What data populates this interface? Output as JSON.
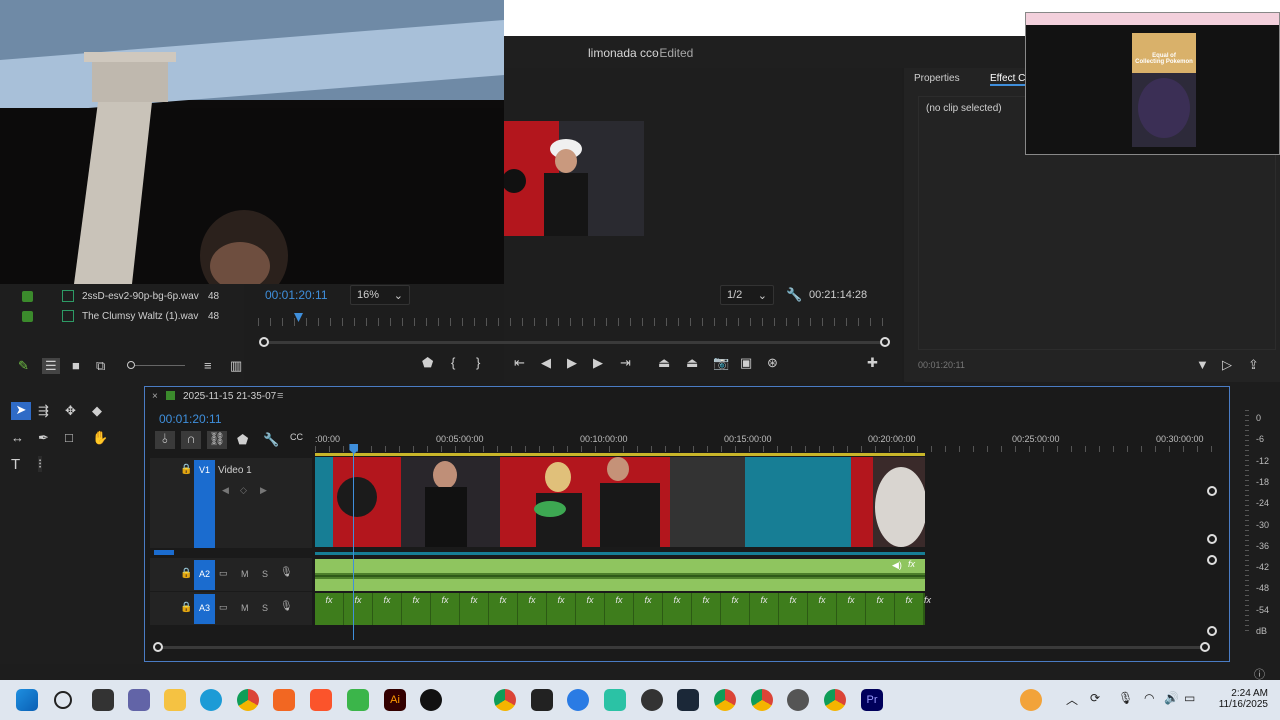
{
  "window": {
    "project_title": "limonada cco",
    "project_status": "- Edited"
  },
  "right_panel": {
    "tabs": [
      "Properties",
      "Effect Co"
    ],
    "no_clip": "(no clip selected)",
    "timecode": "00:01:20:11"
  },
  "program_monitor": {
    "current_timecode": "00:01:20:11",
    "zoom": "16%",
    "resolution": "1/2",
    "duration": "00:21:14:28"
  },
  "project_bin": {
    "items": [
      {
        "name": "2ssD-esv2-90p-bg-6p.wav",
        "count": "48"
      },
      {
        "name": "The Clumsy Waltz (1).wav",
        "count": "48"
      }
    ]
  },
  "timeline": {
    "sequence_name": "2025-11-15 21-35-07",
    "timecode": "00:01:20:11",
    "ruler": [
      ":00:00",
      "00:05:00:00",
      "00:10:00:00",
      "00:15:00:00",
      "00:20:00:00",
      "00:25:00:00",
      "00:30:00:00"
    ],
    "playhead_fraction": 0.063,
    "tracks": {
      "v1": {
        "id": "V1",
        "name": "Video 1"
      },
      "a2": {
        "id": "A2",
        "m": "M",
        "s": "S"
      },
      "a3": {
        "id": "A3",
        "m": "M",
        "s": "S"
      }
    },
    "fx_label": "fx"
  },
  "audio_meter": {
    "labels": [
      "0",
      "-6",
      "-12",
      "-18",
      "-24",
      "-30",
      "-36",
      "-42",
      "-48",
      "-54",
      "dB"
    ]
  },
  "pip": {
    "caption_line1": "Equal of",
    "caption_line2": "Collecting Pokemon"
  },
  "taskbar": {
    "time": "2:24 AM",
    "date": "11/16/2025"
  },
  "colors": {
    "accent_blue": "#3f8fdc",
    "track_blue": "#1b6ccf",
    "audio_green": "#3e7d1c",
    "audio_light": "#8fc55f",
    "clip_teal": "#177e95"
  }
}
